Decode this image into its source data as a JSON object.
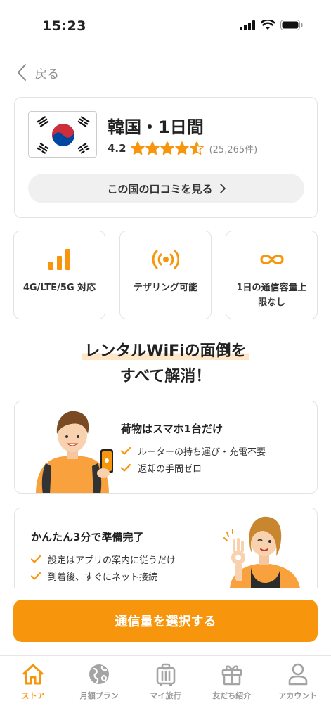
{
  "status_bar": {
    "time": "15:23"
  },
  "nav": {
    "back_label": "戻る"
  },
  "product": {
    "title": "韓国・1日間",
    "rating": "4.2",
    "stars_filled": 4.5,
    "review_count": "(25,265件)",
    "reviews_button": "この国の口コミを見る"
  },
  "features": [
    {
      "icon": "signal-bars-icon",
      "label": "4G/LTE/5G 対応"
    },
    {
      "icon": "tethering-icon",
      "label": "テザリング可能"
    },
    {
      "icon": "infinity-icon",
      "label": "1日の通信容量上限なし"
    }
  ],
  "headline": {
    "line1": "レンタルWiFiの面倒を",
    "line2": "すべて解消！"
  },
  "promos": [
    {
      "title": "荷物はスマホ1台だけ",
      "items": [
        "ルーターの持ち運び・充電不要",
        "返却の手間ゼロ"
      ]
    },
    {
      "title": "かんたん3分で準備完了",
      "items": [
        "設定はアプリの案内に従うだけ",
        "到着後、すぐにネット接続"
      ]
    }
  ],
  "cta": {
    "label": "通信量を選択する"
  },
  "tabs": [
    {
      "label": "ストア",
      "icon": "home-icon",
      "active": true
    },
    {
      "label": "月額プラン",
      "icon": "globe-icon",
      "active": false
    },
    {
      "label": "マイ旅行",
      "icon": "luggage-icon",
      "active": false
    },
    {
      "label": "友だち紹介",
      "icon": "gift-icon",
      "active": false
    },
    {
      "label": "アカウント",
      "icon": "person-icon",
      "active": false
    }
  ],
  "colors": {
    "accent": "#f7960c",
    "text": "#222222",
    "muted": "#9a9a9a",
    "border": "#e3e3e3"
  }
}
